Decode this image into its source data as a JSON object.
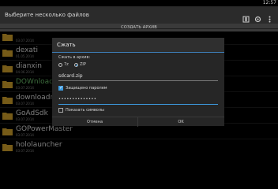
{
  "status": {
    "time": "12:57"
  },
  "appbar": {
    "title": "Выберите несколько файлов",
    "icons": [
      "archive-icon",
      "settings-icon",
      "overflow-menu-icon"
    ]
  },
  "create_bar": {
    "label": "СОЗДАТЬ АРХИВ"
  },
  "files": [
    {
      "name": "",
      "date": "03.07.2014"
    },
    {
      "name": "dexati",
      "date": "01.05.2014"
    },
    {
      "name": "dianxin",
      "date": "04.06.2014"
    },
    {
      "name": "DOWnload",
      "date": "03.07.2014"
    },
    {
      "name": "downloadman",
      "date": "03.07.2014"
    },
    {
      "name": "GoAdSdk",
      "date": "03.07.2014"
    },
    {
      "name": "GOPowerMaster",
      "date": "03.07.2014"
    },
    {
      "name": "hololauncher",
      "date": "03.07.2014"
    }
  ],
  "dialog": {
    "title": "Сжать",
    "format_label": "Сжать в архив:",
    "formats": [
      {
        "label": "7z",
        "selected": false
      },
      {
        "label": "ZIP",
        "selected": true
      }
    ],
    "archive_name": "sdcard.zip",
    "password_protect": {
      "label": "Защищено паролем",
      "checked": true
    },
    "password_value": "••••••••••••••",
    "show_symbols": {
      "label": "Показать символы",
      "checked": false
    },
    "cancel_label": "Отмена",
    "ok_label": "OK"
  },
  "colors": {
    "accent": "#3d9be0",
    "folder": "#d7a72d",
    "highlight_text": "#6ec36e"
  }
}
